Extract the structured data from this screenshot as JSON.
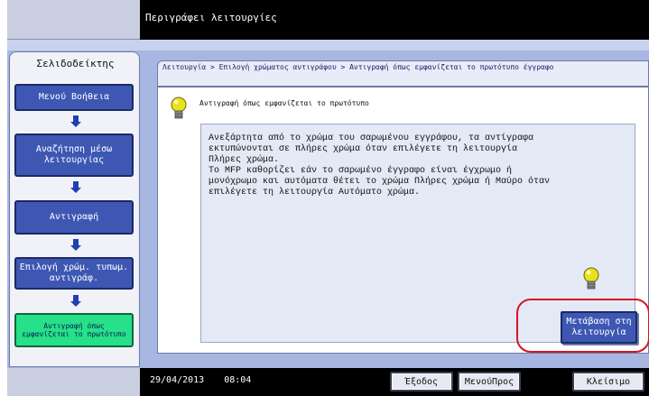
{
  "header": {
    "title": "Περιγράφει λειτουργίες"
  },
  "sidebar": {
    "title": "Σελιδοδείκτης",
    "items": [
      {
        "label": "Μενού Βοήθεια"
      },
      {
        "label": "Αναζήτηση μέσω λειτουργίας"
      },
      {
        "label": "Αντιγραφή"
      },
      {
        "label": "Επιλογή χρώμ. τυπωμ. αντιγράφ."
      },
      {
        "label": "Αντιγραφή όπως εμφανίζεται το πρωτότυπο"
      }
    ]
  },
  "breadcrumb": "Λειτουργία > Επιλογή χρώματος αντιγράφου > Αντιγραφή όπως εμφανίζεται το πρωτότυπο έγγραφο",
  "content": {
    "heading": "Αντιγραφή όπως εμφανίζεται το πρωτότυπο",
    "body": "Ανεξάρτητα από το χρώμα του σαρωμένου εγγράφου, τα αντίγραφα\nεκτυπώνονται σε πλήρες χρώμα όταν επιλέγετε τη λειτουργία\nΠλήρες χρώμα.\nΤο MFP καθορίζει εάν το σαρωμένο έγγραφο είναι έγχρωμο ή\nμονόχρωμο και αυτόματα θέτει το χρώμα Πλήρες χρώμα ή Μαύρο όταν\nεπιλέγετε τη λειτουργία Αυτόματο χρώμα.",
    "goto_button": "Μετάβαση στη λειτουργία"
  },
  "footer": {
    "date": "29/04/2013",
    "time": "08:04",
    "exit_button": "Έξοδος",
    "menu_button": "ΜενούΠρος",
    "close_button": "Κλείσιμο"
  },
  "colors": {
    "accent_blue": "#3d57b3",
    "current_green": "#26e08a",
    "highlight_red": "#d8141e"
  },
  "icons": [
    "lightbulb-icon",
    "down-arrow-icon"
  ]
}
